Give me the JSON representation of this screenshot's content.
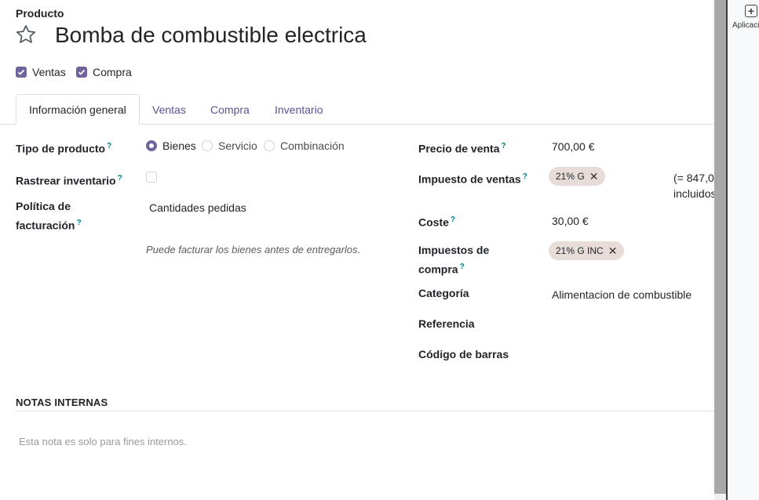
{
  "header": {
    "label": "Producto",
    "product_name": "Bomba de combustible electrica"
  },
  "checkboxes": {
    "ventas": {
      "label": "Ventas",
      "checked": true
    },
    "compra": {
      "label": "Compra",
      "checked": true
    }
  },
  "tabs": [
    {
      "label": "Información general",
      "active": true
    },
    {
      "label": "Ventas",
      "active": false
    },
    {
      "label": "Compra",
      "active": false
    },
    {
      "label": "Inventario",
      "active": false
    }
  ],
  "left": {
    "tipo_producto": {
      "label": "Tipo de producto",
      "help": "?",
      "options": [
        "Bienes",
        "Servicio",
        "Combinación"
      ],
      "selected": "Bienes"
    },
    "rastrear": {
      "label": "Rastrear inventario",
      "help": "?",
      "checked": false
    },
    "politica": {
      "label_line1": "Política de",
      "label_line2": "facturación",
      "help": "?",
      "value": "Cantidades pedidas",
      "hint": "Puede facturar los bienes antes de entregarlos."
    }
  },
  "right": {
    "precio_venta": {
      "label": "Precio de venta",
      "help": "?",
      "value": "700,00 €"
    },
    "impuesto_ventas": {
      "label": "Impuesto de ventas",
      "help": "?",
      "tag": "21% G",
      "note_line1": "(= 847,0",
      "note_line2": "incluidos"
    },
    "coste": {
      "label": "Coste",
      "help": "?",
      "value": "30,00 €"
    },
    "impuestos_compra": {
      "label_line1": "Impuestos de",
      "label_line2": "compra",
      "help": "?",
      "tag": "21% G INC"
    },
    "categoria": {
      "label": "Categoría",
      "value": "Alimentacion de combustible"
    },
    "referencia": {
      "label": "Referencia"
    },
    "codigo_barras": {
      "label": "Código de barras"
    }
  },
  "notes": {
    "title": "NOTAS INTERNAS",
    "placeholder": "Esta nota es solo para fines internos."
  },
  "side_panel": {
    "label": "Aplicacio"
  },
  "icons": {
    "favorite": "star-outline-icon",
    "apps": "plus-square-icon",
    "remove": "close-icon"
  },
  "colors": {
    "accent": "#71639e",
    "tab_link": "#5f4f98",
    "help": "#017e84",
    "tag_bg": "#e8dcd9"
  }
}
